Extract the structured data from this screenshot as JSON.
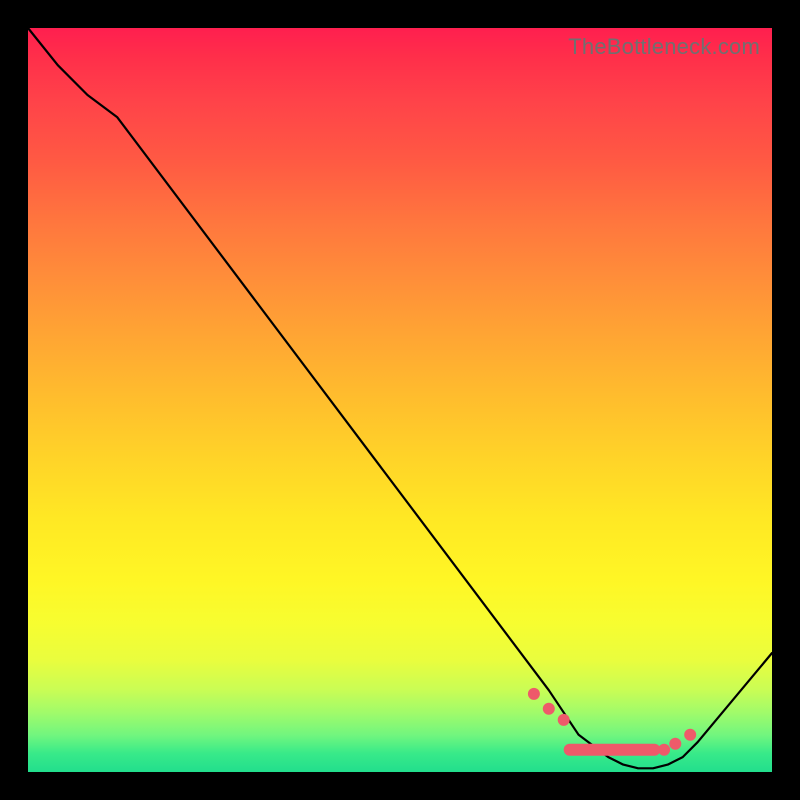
{
  "watermark": "TheBottleneck.com",
  "chart_data": {
    "type": "line",
    "title": "",
    "xlabel": "",
    "ylabel": "",
    "xlim": [
      0,
      100
    ],
    "ylim": [
      0,
      100
    ],
    "series": [
      {
        "name": "bottleneck-curve",
        "x": [
          0,
          4,
          8,
          12,
          70,
          74,
          78,
          80,
          82,
          84,
          86,
          88,
          90,
          100
        ],
        "y": [
          100,
          95,
          91,
          88,
          11,
          5,
          2,
          1,
          0.5,
          0.5,
          1,
          2,
          4,
          16
        ]
      }
    ],
    "markers": {
      "name": "highlight-dots",
      "x": [
        68,
        70,
        72,
        85.5,
        87,
        89
      ],
      "y": [
        10.5,
        8.5,
        7,
        3,
        3.8,
        5
      ]
    },
    "highlight_band": {
      "name": "valley-pill",
      "x_start": 72,
      "x_end": 85,
      "y": 3
    }
  }
}
